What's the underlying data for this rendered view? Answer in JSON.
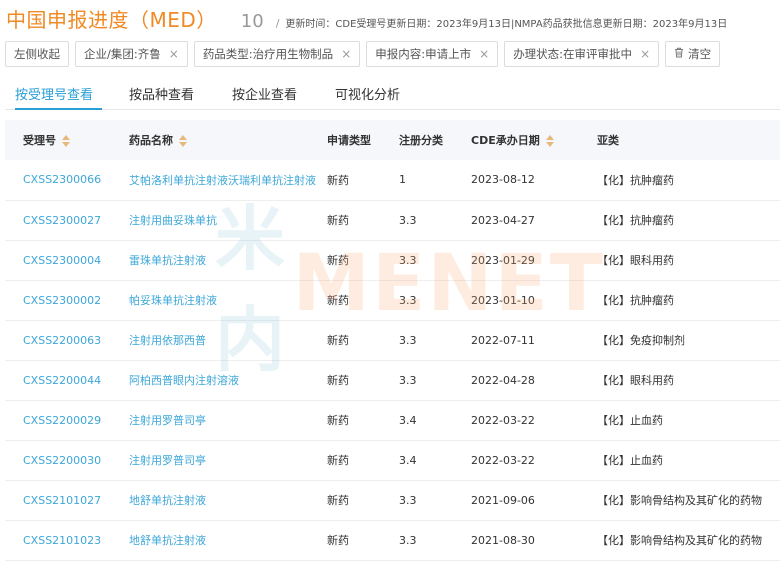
{
  "header": {
    "title": "中国申报进度（MED）",
    "count": "10",
    "separator": "/",
    "update_text": "更新时间：CDE受理号更新日期：2023年9月13日|NMPA药品获批信息更新日期：2023年9月13日"
  },
  "filters": {
    "collapse_label": "左侧收起",
    "chips": [
      {
        "label": "企业/集团:齐鲁"
      },
      {
        "label": "药品类型:治疗用生物制品"
      },
      {
        "label": "申报内容:申请上市"
      },
      {
        "label": "办理状态:在审评审批中"
      }
    ],
    "remove_glyph": "×",
    "clear_label": "清空"
  },
  "tabs": [
    {
      "label": "按受理号查看",
      "active": true
    },
    {
      "label": "按品种查看",
      "active": false
    },
    {
      "label": "按企业查看",
      "active": false
    },
    {
      "label": "可视化分析",
      "active": false
    }
  ],
  "table": {
    "columns": [
      "受理号",
      "药品名称",
      "申请类型",
      "注册分类",
      "CDE承办日期",
      "亚类"
    ],
    "rows": [
      [
        "CXSS2300066",
        "艾帕洛利单抗注射液沃瑞利单抗注射液",
        "新药",
        "1",
        "2023-08-12",
        "【化】抗肿瘤药"
      ],
      [
        "CXSS2300027",
        "注射用曲妥珠单抗",
        "新药",
        "3.3",
        "2023-04-27",
        "【化】抗肿瘤药"
      ],
      [
        "CXSS2300004",
        "雷珠单抗注射液",
        "新药",
        "3.3",
        "2023-01-29",
        "【化】眼科用药"
      ],
      [
        "CXSS2300002",
        "帕妥珠单抗注射液",
        "新药",
        "3.3",
        "2023-01-10",
        "【化】抗肿瘤药"
      ],
      [
        "CXSS2200063",
        "注射用依那西普",
        "新药",
        "3.3",
        "2022-07-11",
        "【化】免疫抑制剂"
      ],
      [
        "CXSS2200044",
        "阿柏西普眼内注射溶液",
        "新药",
        "3.3",
        "2022-04-28",
        "【化】眼科用药"
      ],
      [
        "CXSS2200029",
        "注射用罗普司亭",
        "新药",
        "3.4",
        "2022-03-22",
        "【化】止血药"
      ],
      [
        "CXSS2200030",
        "注射用罗普司亭",
        "新药",
        "3.4",
        "2022-03-22",
        "【化】止血药"
      ],
      [
        "CXSS2101027",
        "地舒单抗注射液",
        "新药",
        "3.3",
        "2021-09-06",
        "【化】影响骨结构及其矿化的药物"
      ],
      [
        "CXSS2101023",
        "地舒单抗注射液",
        "新药",
        "3.3",
        "2021-08-30",
        "【化】影响骨结构及其矿化的药物"
      ]
    ]
  },
  "watermark": {
    "cn": "米内",
    "en": "MENET"
  },
  "colors": {
    "title_orange": "#f08a24",
    "accent_blue": "#2a9fd6",
    "link_blue": "#3ca7d8",
    "header_bg": "#f5f7fa"
  }
}
